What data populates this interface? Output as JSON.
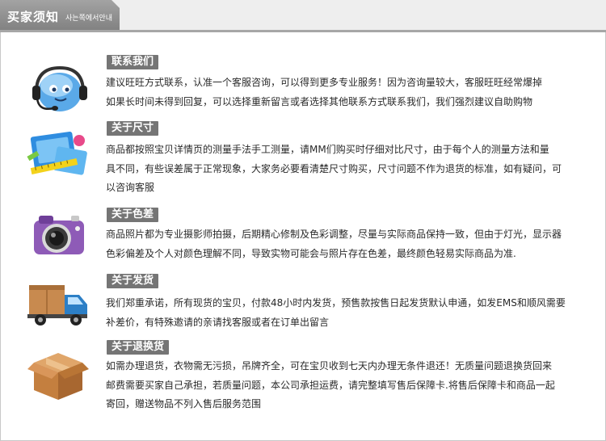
{
  "header": {
    "title": "买家须知",
    "subtitle": "사는쪽에서안내"
  },
  "sections": [
    {
      "title": "联系我们",
      "icon": "customer-service-headset-icon",
      "body": "建议旺旺方式联系，认准一个客服咨询，可以得到更多专业服务！因为咨询量较大，客服旺旺经常爆掉\n如果长时间未得到回复，可以选择重新留言或者选择其他联系方式联系我们，我们强烈建议自助购物"
    },
    {
      "title": "关于尺寸",
      "icon": "measuring-tools-icon",
      "body": "商品都按照宝贝详情页的测量手法手工测量，请MM们购买时仔细对比尺寸，由于每个人的测量方法和量\n具不同，有些误差属于正常现象，大家务必要看清楚尺寸购买，尺寸问题不作为退货的标准，如有疑问，可\n以咨询客服"
    },
    {
      "title": "关于色差",
      "icon": "camera-icon",
      "body": "商品照片都为专业摄影师拍摄，后期精心修制及色彩调整，尽量与实际商品保持一致，但由于灯光，显示器\n色彩偏差及个人对颜色理解不同，导致实物可能会与照片存在色差，最终颜色轻易实际商品为准."
    },
    {
      "title": "关于发货",
      "icon": "delivery-truck-icon",
      "body": "我们郑重承诺，所有现货的宝贝，付款48小时内发货，预售款按售日起发货默认申通，如发EMS和顺风需要\n补差价，有特殊邀请的亲请找客服或者在订单出留言"
    },
    {
      "title": "关于退换货",
      "icon": "cardboard-box-icon",
      "body": "如需办理退货，衣物需无污损，吊牌齐全，可在宝贝收到七天内办理无条件退还！无质量问题退换货回来\n邮费需要买家自己承担，若质量问题，本公司承担运费，请完整填写售后保障卡.将售后保障卡和商品一起\n寄回，赠送物品不列入售后服务范围"
    }
  ]
}
